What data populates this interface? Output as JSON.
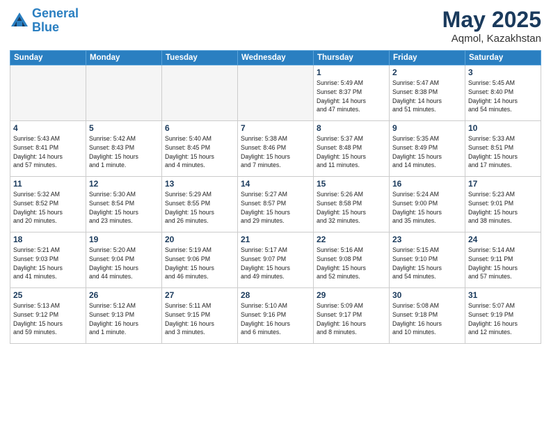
{
  "logo": {
    "line1": "General",
    "line2": "Blue"
  },
  "title": "May 2025",
  "location": "Aqmol, Kazakhstan",
  "days_of_week": [
    "Sunday",
    "Monday",
    "Tuesday",
    "Wednesday",
    "Thursday",
    "Friday",
    "Saturday"
  ],
  "weeks": [
    [
      {
        "day": "",
        "info": ""
      },
      {
        "day": "",
        "info": ""
      },
      {
        "day": "",
        "info": ""
      },
      {
        "day": "",
        "info": ""
      },
      {
        "day": "1",
        "info": "Sunrise: 5:49 AM\nSunset: 8:37 PM\nDaylight: 14 hours\nand 47 minutes."
      },
      {
        "day": "2",
        "info": "Sunrise: 5:47 AM\nSunset: 8:38 PM\nDaylight: 14 hours\nand 51 minutes."
      },
      {
        "day": "3",
        "info": "Sunrise: 5:45 AM\nSunset: 8:40 PM\nDaylight: 14 hours\nand 54 minutes."
      }
    ],
    [
      {
        "day": "4",
        "info": "Sunrise: 5:43 AM\nSunset: 8:41 PM\nDaylight: 14 hours\nand 57 minutes."
      },
      {
        "day": "5",
        "info": "Sunrise: 5:42 AM\nSunset: 8:43 PM\nDaylight: 15 hours\nand 1 minute."
      },
      {
        "day": "6",
        "info": "Sunrise: 5:40 AM\nSunset: 8:45 PM\nDaylight: 15 hours\nand 4 minutes."
      },
      {
        "day": "7",
        "info": "Sunrise: 5:38 AM\nSunset: 8:46 PM\nDaylight: 15 hours\nand 7 minutes."
      },
      {
        "day": "8",
        "info": "Sunrise: 5:37 AM\nSunset: 8:48 PM\nDaylight: 15 hours\nand 11 minutes."
      },
      {
        "day": "9",
        "info": "Sunrise: 5:35 AM\nSunset: 8:49 PM\nDaylight: 15 hours\nand 14 minutes."
      },
      {
        "day": "10",
        "info": "Sunrise: 5:33 AM\nSunset: 8:51 PM\nDaylight: 15 hours\nand 17 minutes."
      }
    ],
    [
      {
        "day": "11",
        "info": "Sunrise: 5:32 AM\nSunset: 8:52 PM\nDaylight: 15 hours\nand 20 minutes."
      },
      {
        "day": "12",
        "info": "Sunrise: 5:30 AM\nSunset: 8:54 PM\nDaylight: 15 hours\nand 23 minutes."
      },
      {
        "day": "13",
        "info": "Sunrise: 5:29 AM\nSunset: 8:55 PM\nDaylight: 15 hours\nand 26 minutes."
      },
      {
        "day": "14",
        "info": "Sunrise: 5:27 AM\nSunset: 8:57 PM\nDaylight: 15 hours\nand 29 minutes."
      },
      {
        "day": "15",
        "info": "Sunrise: 5:26 AM\nSunset: 8:58 PM\nDaylight: 15 hours\nand 32 minutes."
      },
      {
        "day": "16",
        "info": "Sunrise: 5:24 AM\nSunset: 9:00 PM\nDaylight: 15 hours\nand 35 minutes."
      },
      {
        "day": "17",
        "info": "Sunrise: 5:23 AM\nSunset: 9:01 PM\nDaylight: 15 hours\nand 38 minutes."
      }
    ],
    [
      {
        "day": "18",
        "info": "Sunrise: 5:21 AM\nSunset: 9:03 PM\nDaylight: 15 hours\nand 41 minutes."
      },
      {
        "day": "19",
        "info": "Sunrise: 5:20 AM\nSunset: 9:04 PM\nDaylight: 15 hours\nand 44 minutes."
      },
      {
        "day": "20",
        "info": "Sunrise: 5:19 AM\nSunset: 9:06 PM\nDaylight: 15 hours\nand 46 minutes."
      },
      {
        "day": "21",
        "info": "Sunrise: 5:17 AM\nSunset: 9:07 PM\nDaylight: 15 hours\nand 49 minutes."
      },
      {
        "day": "22",
        "info": "Sunrise: 5:16 AM\nSunset: 9:08 PM\nDaylight: 15 hours\nand 52 minutes."
      },
      {
        "day": "23",
        "info": "Sunrise: 5:15 AM\nSunset: 9:10 PM\nDaylight: 15 hours\nand 54 minutes."
      },
      {
        "day": "24",
        "info": "Sunrise: 5:14 AM\nSunset: 9:11 PM\nDaylight: 15 hours\nand 57 minutes."
      }
    ],
    [
      {
        "day": "25",
        "info": "Sunrise: 5:13 AM\nSunset: 9:12 PM\nDaylight: 15 hours\nand 59 minutes."
      },
      {
        "day": "26",
        "info": "Sunrise: 5:12 AM\nSunset: 9:13 PM\nDaylight: 16 hours\nand 1 minute."
      },
      {
        "day": "27",
        "info": "Sunrise: 5:11 AM\nSunset: 9:15 PM\nDaylight: 16 hours\nand 3 minutes."
      },
      {
        "day": "28",
        "info": "Sunrise: 5:10 AM\nSunset: 9:16 PM\nDaylight: 16 hours\nand 6 minutes."
      },
      {
        "day": "29",
        "info": "Sunrise: 5:09 AM\nSunset: 9:17 PM\nDaylight: 16 hours\nand 8 minutes."
      },
      {
        "day": "30",
        "info": "Sunrise: 5:08 AM\nSunset: 9:18 PM\nDaylight: 16 hours\nand 10 minutes."
      },
      {
        "day": "31",
        "info": "Sunrise: 5:07 AM\nSunset: 9:19 PM\nDaylight: 16 hours\nand 12 minutes."
      }
    ]
  ]
}
